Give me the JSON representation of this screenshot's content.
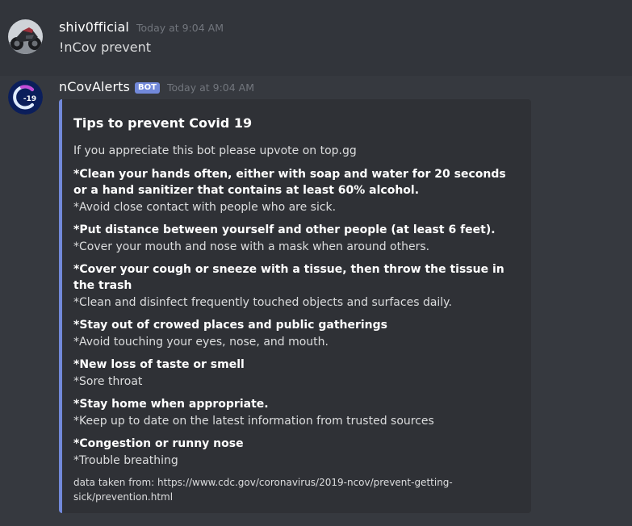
{
  "messages": [
    {
      "username": "shiv0fficial",
      "timestamp": "Today at 9:04 AM",
      "content": "!nCov prevent",
      "avatar_icon": "motorcycle-avatar"
    },
    {
      "username": "nCovAlerts",
      "bot_tag": "BOT",
      "timestamp": "Today at 9:04 AM",
      "avatar_icon": "covid-19-logo-avatar",
      "avatar_label": "-19",
      "embed": {
        "accent_color": "#7289da",
        "title": "Tips to prevent Covid 19",
        "description": "If you appreciate this bot please upvote on top.gg",
        "fields": [
          {
            "name": "*Clean your hands often, either with soap and water for 20 seconds or a hand sanitizer that contains at least 60% alcohol.",
            "value": "*Avoid close contact with people who are sick."
          },
          {
            "name": "*Put distance between yourself and other people (at least 6 feet).",
            "value": "*Cover your mouth and nose with a mask when around others."
          },
          {
            "name": "*Cover your cough or sneeze with a tissue, then throw the tissue in the trash",
            "value": "*Clean and disinfect frequently touched objects and surfaces daily."
          },
          {
            "name": "*Stay out of crowed places and public gatherings",
            "value": "*Avoid touching your eyes, nose, and mouth."
          },
          {
            "name": "*New loss of taste or smell",
            "value": "*Sore throat"
          },
          {
            "name": "*Stay home when appropriate.",
            "value": "*Keep up to date on the latest information from trusted sources"
          },
          {
            "name": "*Congestion or runny nose",
            "value": "*Trouble breathing"
          }
        ],
        "footer": "data taken from: https://www.cdc.gov/coronavirus/2019-ncov/prevent-getting-sick/prevention.html"
      }
    }
  ],
  "colors": {
    "background": "#36393f",
    "hover_background": "#32353b",
    "embed_background": "#2f3136",
    "bot_tag": "#7289da",
    "timestamp": "#72767d"
  }
}
